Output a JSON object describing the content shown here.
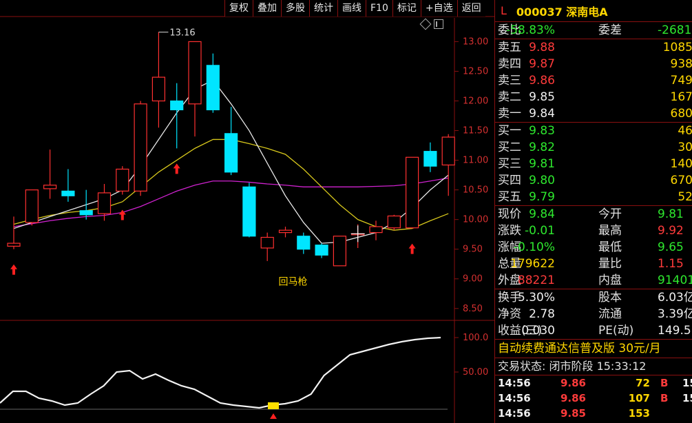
{
  "toolbar": [
    "复权",
    "叠加",
    "多股",
    "统计",
    "画线",
    "F10",
    "标记",
    "+自选",
    "返回"
  ],
  "chart_data": {
    "type": "candlestick",
    "price_axis": [
      "13.00",
      "12.50",
      "12.00",
      "11.50",
      "11.00",
      "10.50",
      "10.00",
      "9.50",
      "9.00",
      "8.50"
    ],
    "ylim": [
      8.3,
      13.4
    ],
    "max_label": "13.16",
    "annotation": "回马枪",
    "candles": [
      {
        "o": 9.55,
        "h": 10.05,
        "l": 9.5,
        "c": 9.6
      },
      {
        "o": 9.95,
        "h": 10.5,
        "l": 9.9,
        "c": 10.5
      },
      {
        "o": 10.52,
        "h": 11.18,
        "l": 10.35,
        "c": 10.58
      },
      {
        "o": 10.48,
        "h": 10.85,
        "l": 10.3,
        "c": 10.4
      },
      {
        "o": 10.15,
        "h": 10.5,
        "l": 10.0,
        "c": 10.08
      },
      {
        "o": 10.1,
        "h": 10.6,
        "l": 9.98,
        "c": 10.45
      },
      {
        "o": 10.48,
        "h": 10.9,
        "l": 10.42,
        "c": 10.85
      },
      {
        "o": 10.48,
        "h": 12.0,
        "l": 10.4,
        "c": 11.95
      },
      {
        "o": 12.0,
        "h": 13.16,
        "l": 11.55,
        "c": 12.4
      },
      {
        "o": 12.0,
        "h": 12.3,
        "l": 11.2,
        "c": 11.85
      },
      {
        "o": 11.95,
        "h": 13.0,
        "l": 11.4,
        "c": 13.0
      },
      {
        "o": 12.6,
        "h": 12.8,
        "l": 11.8,
        "c": 11.85
      },
      {
        "o": 11.45,
        "h": 11.9,
        "l": 10.75,
        "c": 10.8
      },
      {
        "o": 10.55,
        "h": 10.62,
        "l": 9.7,
        "c": 9.72
      },
      {
        "o": 9.52,
        "h": 9.78,
        "l": 9.3,
        "c": 9.7
      },
      {
        "o": 9.78,
        "h": 9.88,
        "l": 9.7,
        "c": 9.82
      },
      {
        "o": 9.72,
        "h": 9.78,
        "l": 9.42,
        "c": 9.5
      },
      {
        "o": 9.57,
        "h": 9.6,
        "l": 9.35,
        "c": 9.4
      },
      {
        "o": 9.22,
        "h": 9.72,
        "l": 9.22,
        "c": 9.72
      },
      {
        "o": 9.76,
        "h": 9.92,
        "l": 9.52,
        "c": 9.76
      },
      {
        "o": 9.78,
        "h": 9.98,
        "l": 9.65,
        "c": 9.88
      },
      {
        "o": 9.86,
        "h": 10.08,
        "l": 9.82,
        "c": 10.06
      },
      {
        "o": 9.86,
        "h": 11.05,
        "l": 9.85,
        "c": 11.05
      },
      {
        "o": 11.15,
        "h": 11.3,
        "l": 10.8,
        "c": 10.9
      },
      {
        "o": 10.92,
        "h": 11.44,
        "l": 10.4,
        "c": 11.39
      }
    ],
    "ma_white": [
      9.85,
      9.95,
      10.05,
      10.15,
      10.25,
      10.35,
      10.5,
      10.9,
      11.35,
      11.8,
      12.2,
      12.35,
      11.95,
      11.5,
      10.95,
      10.4,
      9.95,
      9.6,
      9.62,
      9.7,
      9.78,
      9.95,
      10.2,
      10.5,
      10.75
    ],
    "ma_yellow": [
      9.92,
      10.0,
      10.07,
      10.12,
      10.15,
      10.2,
      10.3,
      10.55,
      10.8,
      11.0,
      11.2,
      11.35,
      11.35,
      11.28,
      11.2,
      11.1,
      10.85,
      10.55,
      10.25,
      10.0,
      9.88,
      9.82,
      9.85,
      9.98,
      10.1
    ],
    "ma_magenta": [
      9.88,
      9.93,
      9.98,
      10.02,
      10.05,
      10.07,
      10.12,
      10.22,
      10.35,
      10.48,
      10.58,
      10.65,
      10.65,
      10.63,
      10.6,
      10.58,
      10.55,
      10.55,
      10.55,
      10.55,
      10.56,
      10.57,
      10.6,
      10.65,
      10.7
    ],
    "buy_arrows": [
      0,
      6,
      9,
      22
    ],
    "osc_axis": [
      "100.0",
      "50.00"
    ],
    "osc": [
      5,
      22,
      22,
      12,
      8,
      2,
      5,
      18,
      30,
      50,
      52,
      40,
      47,
      38,
      30,
      25,
      15,
      5,
      2,
      0,
      -2,
      2,
      4,
      8,
      18,
      45,
      60,
      75,
      80,
      85,
      90,
      94,
      97,
      99,
      100
    ]
  },
  "quote": {
    "l": "L",
    "code": "000037 深南电A",
    "weibi_label": "委比",
    "weibi": "-58.83%",
    "weicha_label": "委差",
    "weicha": "-2681",
    "sells": [
      {
        "label": "卖五",
        "price": "9.88",
        "vol": "1085"
      },
      {
        "label": "卖四",
        "price": "9.87",
        "vol": "938"
      },
      {
        "label": "卖三",
        "price": "9.86",
        "vol": "749"
      },
      {
        "label": "卖二",
        "price": "9.85",
        "vol": "167"
      },
      {
        "label": "卖一",
        "price": "9.84",
        "vol": "680"
      }
    ],
    "buys": [
      {
        "label": "买一",
        "price": "9.83",
        "vol": "46"
      },
      {
        "label": "买二",
        "price": "9.82",
        "vol": "30"
      },
      {
        "label": "买三",
        "price": "9.81",
        "vol": "140"
      },
      {
        "label": "买四",
        "price": "9.80",
        "vol": "670"
      },
      {
        "label": "买五",
        "price": "9.79",
        "vol": "52"
      }
    ],
    "stats": [
      {
        "k1": "现价",
        "v1": "9.84",
        "k2": "今开",
        "v2": "9.81"
      },
      {
        "k1": "涨跌",
        "v1": "-0.01",
        "k2": "最高",
        "v2": "9.92"
      },
      {
        "k1": "涨幅",
        "v1": "-0.10%",
        "k2": "最低",
        "v2": "9.65"
      },
      {
        "k1": "总量",
        "v1": "179622",
        "k2": "量比",
        "v2": "1.15"
      },
      {
        "k1": "外盘",
        "v1": "88221",
        "k2": "内盘",
        "v2": "91401"
      }
    ],
    "fund": [
      {
        "k1": "换手",
        "v1": "5.30%",
        "k2": "股本",
        "v2": "6.03亿"
      },
      {
        "k1": "净资",
        "v1": "2.78",
        "k2": "流通",
        "v2": "3.39亿"
      },
      {
        "k1": "收益(三)",
        "v1": "0.030",
        "k2": "PE(动)",
        "v2": "149.5"
      }
    ],
    "ad": "自动续费通达信普及版  30元/月",
    "status": "交易状态: 闭市阶段 15:33:12",
    "ticks": [
      {
        "time": "14:56",
        "price": "9.86",
        "vol": "72",
        "bs": "B",
        "n": "15"
      },
      {
        "time": "14:56",
        "price": "9.86",
        "vol": "107",
        "bs": "B",
        "n": "15"
      },
      {
        "time": "14:56",
        "price": "9.85",
        "vol": "153",
        "bs": "",
        "n": ""
      }
    ]
  },
  "colors": {
    "up": "#ff3030",
    "down": "#00e5ff",
    "ma_white": "#e8e8e8",
    "ma_yellow": "#d8c81c",
    "ma_magenta": "#d022d0",
    "axis": "#8a1010"
  }
}
